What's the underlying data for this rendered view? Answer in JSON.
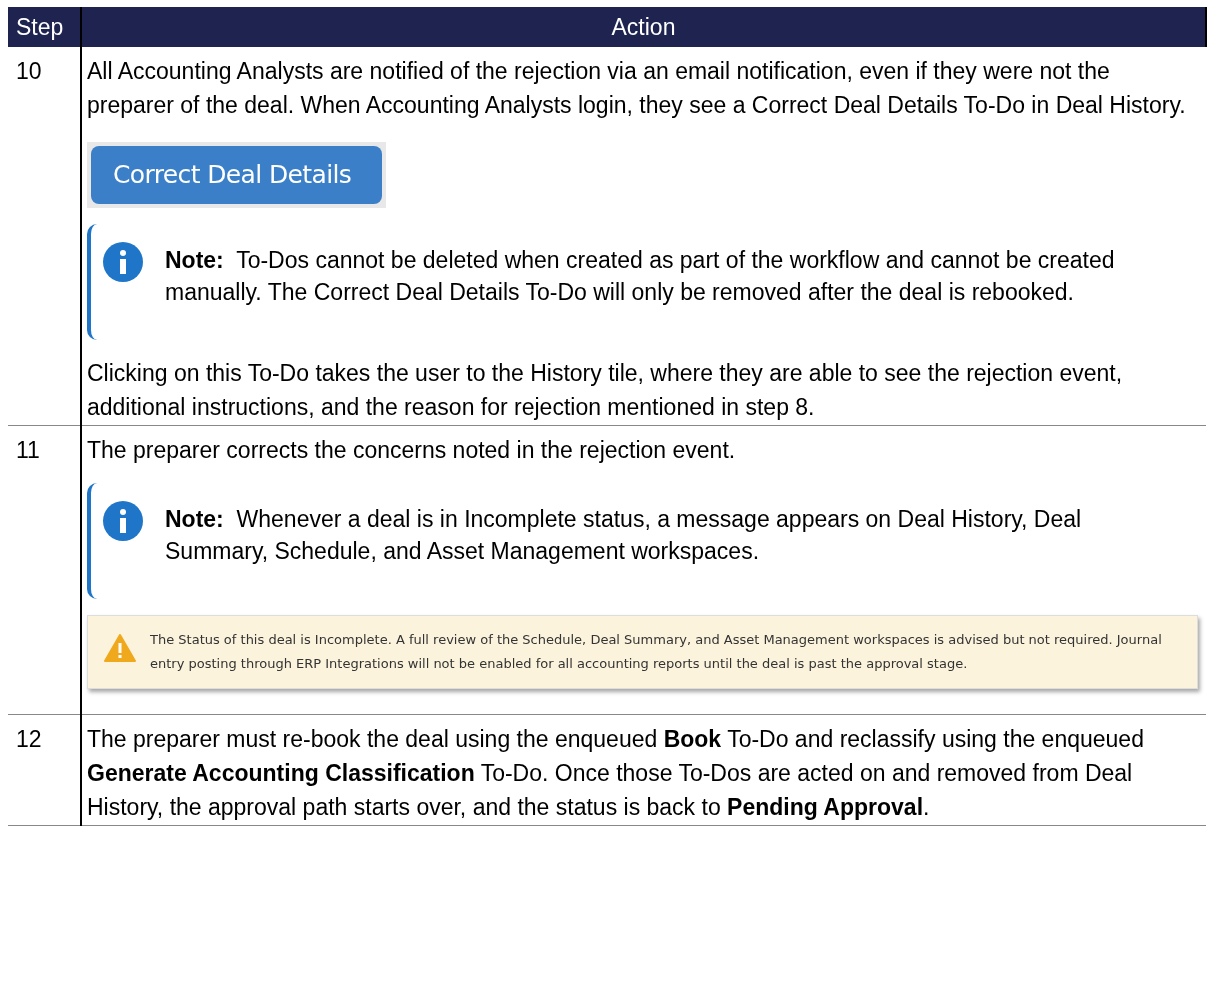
{
  "table": {
    "columns": [
      "Step",
      "Action"
    ],
    "rows": [
      {
        "step": "10",
        "blocks": [
          {
            "kind": "paragraph",
            "text": "All Accounting Analysts are notified of the rejection via an email notification, even if they were not the preparer of the deal. When Accounting Analysts login, they see a Correct Deal Details To-Do in Deal History."
          },
          {
            "kind": "button",
            "text": "Correct Deal Details"
          },
          {
            "kind": "note",
            "label": "Note:",
            "text": "To-Dos cannot be deleted when created as part of the workflow and cannot be created manually. The Correct Deal Details To-Do will only be removed after the deal is rebooked."
          },
          {
            "kind": "paragraph",
            "text": "Clicking on this To-Do takes the user to the History tile, where they are able to see the rejection event, additional instructions, and the reason for rejection mentioned in step 8."
          }
        ]
      },
      {
        "step": "11",
        "blocks": [
          {
            "kind": "paragraph",
            "text": "The preparer corrects the concerns noted in the rejection event."
          },
          {
            "kind": "note",
            "label": "Note:",
            "text": "Whenever a deal is in Incomplete status, a message appears on Deal History, Deal Summary, Schedule, and Asset Management workspaces."
          },
          {
            "kind": "alert",
            "text": "The Status of this deal is Incomplete. A full review of the Schedule, Deal Summary, and Asset Management workspaces is advised but not required. Journal entry posting through ERP Integrations will not be enabled for all accounting reports until the deal is past the approval stage."
          }
        ]
      },
      {
        "step": "12",
        "blocks": [
          {
            "kind": "paragraph",
            "text": "The preparer must re-book the deal using the enqueued **Book** To-Do and reclassify using the enqueued **Generate Accounting Classification** To-Do. Once those To-Dos are acted on and removed from Deal History, the approval path starts over, and the status is back to **Pending Approval**."
          }
        ]
      }
    ]
  }
}
